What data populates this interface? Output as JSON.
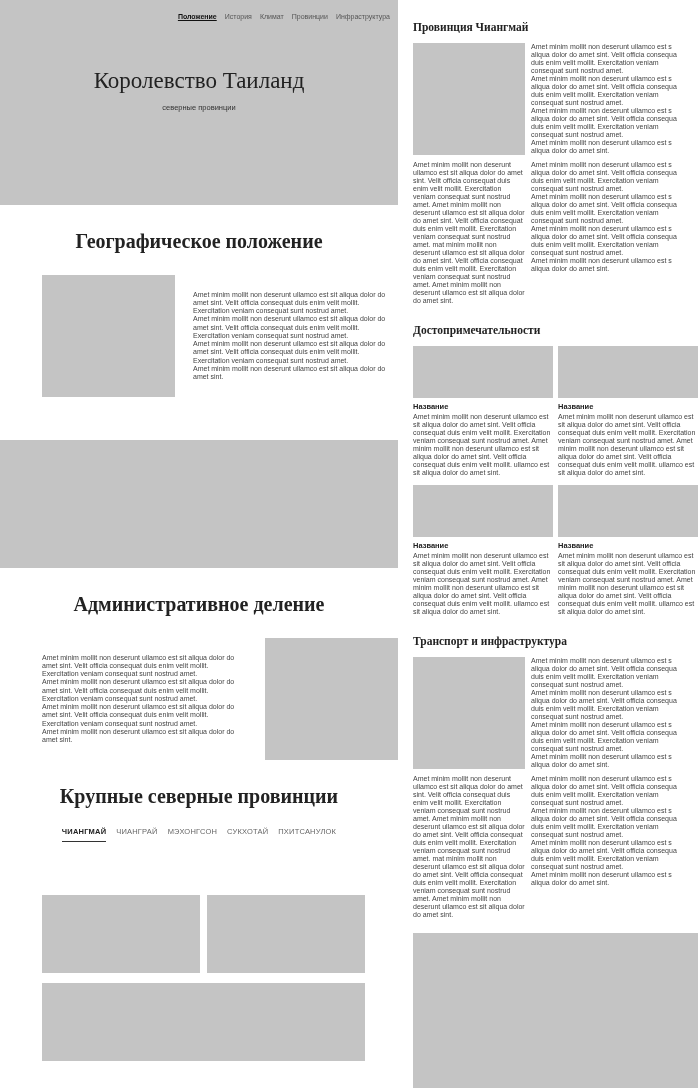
{
  "left_page": {
    "blocks": [
      {
        "kind": "hero",
        "nav": [
          {
            "label": "Положение",
            "selected": true
          },
          {
            "label": "История",
            "selected": false
          },
          {
            "label": "Климат",
            "selected": false
          },
          {
            "label": "Провинции",
            "selected": false
          },
          {
            "label": "Инфраструктура",
            "selected": false
          }
        ],
        "title": "Королевство Таиланд",
        "subtitle": "северные провинции"
      },
      {
        "kind": "heading",
        "text": "Географическое положение"
      },
      {
        "kind": "image_text",
        "text": "Amet minim mollit non deserunt ullamco est sit aliqua dolor do amet sint. Velit officia consequat duis enim velit mollit. Exercitation veniam consequat sunt nostrud amet.\nAmet minim mollit non deserunt ullamco est sit aliqua dolor do amet sint. Velit officia consequat duis enim velit mollit. Exercitation veniam consequat sunt nostrud amet.\nAmet minim mollit non deserunt ullamco est sit aliqua dolor do amet sint. Velit officia consequat duis enim velit mollit. Exercitation veniam consequat sunt nostrud amet.\nAmet minim mollit non deserunt ullamco est sit aliqua dolor do amet sint."
      },
      {
        "kind": "image_wide"
      },
      {
        "kind": "heading",
        "text": "Административное деление"
      },
      {
        "kind": "text_image",
        "text": "Amet minim mollit non deserunt ullamco est sit aliqua dolor do amet sint. Velit officia consequat duis enim velit mollit. Exercitation veniam consequat sunt nostrud amet.\nAmet minim mollit non deserunt ullamco est sit aliqua dolor do amet sint. Velit officia consequat duis enim velit mollit. Exercitation veniam consequat sunt nostrud amet.\nAmet minim mollit non deserunt ullamco est sit aliqua dolor do amet sint. Velit officia consequat duis enim velit mollit. Exercitation veniam consequat sunt nostrud amet.\nAmet minim mollit non deserunt ullamco est sit aliqua dolor do amet sint."
      },
      {
        "kind": "heading",
        "text": "Крупные северные провинции"
      },
      {
        "kind": "tabs",
        "tabs": [
          {
            "label": "ЧИАНГМАЙ",
            "selected": true
          },
          {
            "label": "ЧИАНГРАЙ",
            "selected": false
          },
          {
            "label": "МЭХОНГСОН",
            "selected": false
          },
          {
            "label": "СУКХОТАЙ",
            "selected": false
          },
          {
            "label": "ПХИТСАНУЛОК",
            "selected": false
          }
        ]
      },
      {
        "kind": "image_pair"
      },
      {
        "kind": "image_wide_inset"
      }
    ]
  },
  "right_page": {
    "blocks": [
      {
        "kind": "heading",
        "text": "Провинция Чиангмай"
      },
      {
        "kind": "image_text_grid",
        "texts": [
          "Amet minim mollit non deserunt ullamco est s\naliqua dolor do amet sint. Velit officia consequa\nduis enim velit mollit. Exercitation veniam\nconsequat sunt nostrud amet.\nAmet minim mollit non deserunt ullamco est s\naliqua dolor do amet sint. Velit officia consequa\nduis enim velit mollit. Exercitation veniam\nconsequat sunt nostrud amet.\nAmet minim mollit non deserunt ullamco est s\naliqua dolor do amet sint. Velit officia consequa\nduis enim velit mollit. Exercitation veniam\nconsequat sunt nostrud amet.\nAmet minim mollit non deserunt ullamco est s\naliqua dolor do amet sint.",
          "Amet minim mollit non deserunt ullamco est sit aliqua dolor do amet sint. Velit officia consequat duis enim velit mollit. Exercitation veniam consequat sunt nostrud amet. Amet minim mollit non deserunt ullamco est sit aliqua dolor do amet sint. Velit officia consequat duis enim velit mollit. Exercitation veniam consequat sunt nostrud amet. mat minim mollit non deserunt ullamco est sit aliqua dolor do amet sint. Velit officia consequat duis enim velit mollit. Exercitation veniam consequat sunt nostrud amet. Amet minim mollit non deserunt ullamco est sit aliqua dolor do amet sint.",
          "Amet minim mollit non deserunt ullamco est s\naliqua dolor do amet sint. Velit officia consequa\nduis enim velit mollit. Exercitation veniam\nconsequat sunt nostrud amet.\nAmet minim mollit non deserunt ullamco est s\naliqua dolor do amet sint. Velit officia consequa\nduis enim velit mollit. Exercitation veniam\nconsequat sunt nostrud amet.\nAmet minim mollit non deserunt ullamco est s\naliqua dolor do amet sint. Velit officia consequa\nduis enim velit mollit. Exercitation veniam\nconsequat sunt nostrud amet.\nAmet minim mollit non deserunt ullamco est s\naliqua dolor do amet sint."
        ]
      },
      {
        "kind": "heading",
        "text": "Достопримечательности"
      },
      {
        "kind": "cards",
        "cards": [
          {
            "title": "Название",
            "text": "Amet minim mollit non deserunt ullamco est sit aliqua dolor do amet sint. Velit officia consequat duis enim velit mollit. Exercitation veniam consequat sunt nostrud amet. Amet minim mollit non deserunt ullamco est sit aliqua dolor do amet sint. Velit officia consequat duis enim velit mollit. ullamco est sit aliqua dolor do amet sint."
          },
          {
            "title": "Название",
            "text": "Amet minim mollit non deserunt ullamco est sit aliqua dolor do amet sint. Velit officia consequat duis enim velit mollit. Exercitation veniam consequat sunt nostrud amet. Amet minim mollit non deserunt ullamco est sit aliqua dolor do amet sint. Velit officia consequat duis enim velit mollit. ullamco est sit aliqua dolor do amet sint."
          },
          {
            "title": "Название",
            "text": "Amet minim mollit non deserunt ullamco est sit aliqua dolor do amet sint. Velit officia consequat duis enim velit mollit. Exercitation veniam consequat sunt nostrud amet. Amet minim mollit non deserunt ullamco est sit aliqua dolor do amet sint. Velit officia consequat duis enim velit mollit. ullamco est sit aliqua dolor do amet sint."
          },
          {
            "title": "Название",
            "text": "Amet minim mollit non deserunt ullamco est sit aliqua dolor do amet sint. Velit officia consequat duis enim velit mollit. Exercitation veniam consequat sunt nostrud amet. Amet minim mollit non deserunt ullamco est sit aliqua dolor do amet sint. Velit officia consequat duis enim velit mollit. ullamco est sit aliqua dolor do amet sint."
          }
        ]
      },
      {
        "kind": "heading",
        "text": "Транспорт и инфраструктура"
      },
      {
        "kind": "image_text_grid",
        "texts": [
          "Amet minim mollit non deserunt ullamco est s\naliqua dolor do amet sint. Velit officia consequa\nduis enim velit mollit. Exercitation veniam\nconsequat sunt nostrud amet.\nAmet minim mollit non deserunt ullamco est s\naliqua dolor do amet sint. Velit officia consequa\nduis enim velit mollit. Exercitation veniam\nconsequat sunt nostrud amet.\nAmet minim mollit non deserunt ullamco est s\naliqua dolor do amet sint. Velit officia consequa\nduis enim velit mollit. Exercitation veniam\nconsequat sunt nostrud amet.\nAmet minim mollit non deserunt ullamco est s\naliqua dolor do amet sint.",
          "Amet minim mollit non deserunt ullamco est sit aliqua dolor do amet sint. Velit officia consequat duis enim velit mollit. Exercitation veniam consequat sunt nostrud amet. Amet minim mollit non deserunt ullamco est sit aliqua dolor do amet sint. Velit officia consequat duis enim velit mollit. Exercitation veniam consequat sunt nostrud amet. mat minim mollit non deserunt ullamco est sit aliqua dolor do amet sint. Velit officia consequat duis enim velit mollit. Exercitation veniam consequat sunt nostrud amet. Amet minim mollit non deserunt ullamco est sit aliqua dolor do amet sint.",
          "Amet minim mollit non deserunt ullamco est s\naliqua dolor do amet sint. Velit officia consequa\nduis enim velit mollit. Exercitation veniam\nconsequat sunt nostrud amet.\nAmet minim mollit non deserunt ullamco est s\naliqua dolor do amet sint. Velit officia consequa\nduis enim velit mollit. Exercitation veniam\nconsequat sunt nostrud amet.\nAmet minim mollit non deserunt ullamco est s\naliqua dolor do amet sint. Velit officia consequa\nduis enim velit mollit. Exercitation veniam\nconsequat sunt nostrud amet.\nAmet minim mollit non deserunt ullamco est s\naliqua dolor do amet sint."
        ]
      },
      {
        "kind": "image_bottom"
      }
    ]
  }
}
